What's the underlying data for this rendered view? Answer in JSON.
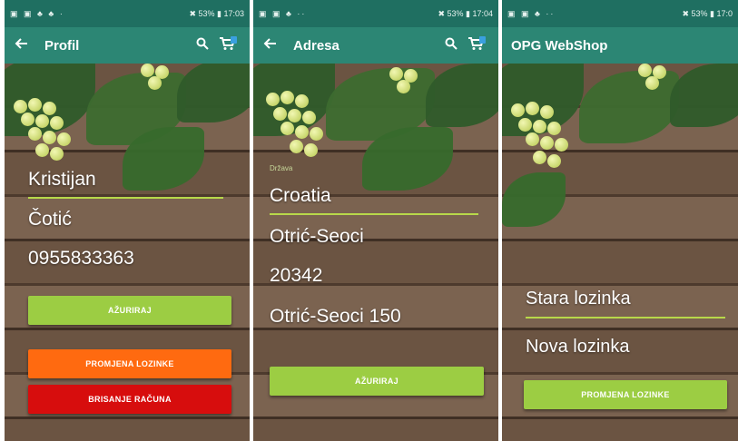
{
  "status_bars": [
    {
      "left": "▣ ▣ ♣ ♣ ·",
      "right": "✖ 53% ▮ 17:03"
    },
    {
      "left": "▣ ▣ ♣ ··",
      "right": "✖ 53% ▮ 17:04"
    },
    {
      "left": "▣ ▣ ♣ ··",
      "right": "✖ 53% ▮ 17:0"
    }
  ],
  "screen_profile": {
    "title": "Profil",
    "first_name": "Kristijan",
    "last_name": "Čotić",
    "phone": "0955833363",
    "update_button": "AŽURIRAJ",
    "change_password_button": "PROMJENA LOZINKE",
    "delete_account_button": "BRISANJE RAČUNA"
  },
  "screen_address": {
    "title": "Adresa",
    "country_hint": "Država",
    "country": "Croatia",
    "place": "Otrić-Seoci",
    "postal_code": "20342",
    "street": "Otrić-Seoci 150",
    "update_button": "AŽURIRAJ"
  },
  "screen_password": {
    "title": "OPG WebShop",
    "old_password_placeholder": "Stara lozinka",
    "new_password_placeholder": "Nova lozinka",
    "change_password_button": "PROMJENA LOZINKE"
  },
  "icons": {
    "back": "arrow-left-icon",
    "search": "search-icon",
    "cart": "cart-icon"
  },
  "colors": {
    "status_bar": "#1f6f61",
    "app_bar": "#2c8674",
    "button_green": "#9ccd43",
    "button_orange": "#ff6a10",
    "button_red": "#d70d0d",
    "field_underline": "#b8d84a"
  },
  "cart_badge": "1"
}
